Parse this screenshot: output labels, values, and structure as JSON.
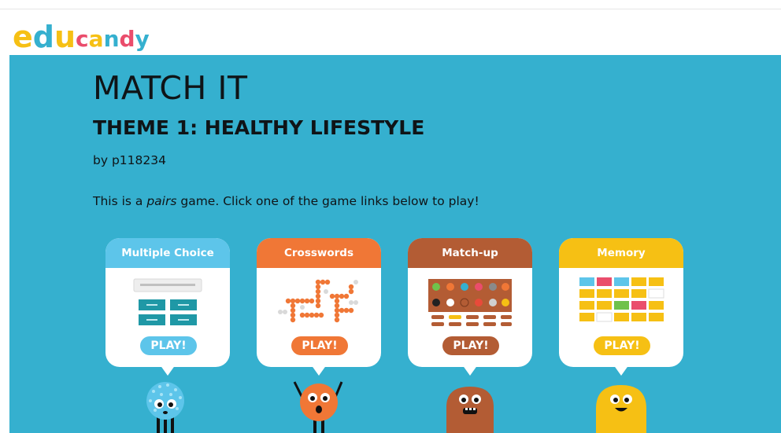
{
  "brand": {
    "logo_text": "educandy",
    "logo_letters": [
      "e",
      "d",
      "u",
      "c",
      "a",
      "n",
      "d",
      "y"
    ]
  },
  "page": {
    "title": "MATCH IT",
    "subtitle": "THEME 1: HEALTHY LIFESTYLE",
    "author": "by p118234",
    "desc_before": "This is a ",
    "desc_em": "pairs",
    "desc_after": " game. Click one of the game links below to play!"
  },
  "colors": {
    "background": "#35b0cf",
    "multiple_choice": "#5dc5ea",
    "crosswords": "#f07736",
    "matchup": "#b35c34",
    "memory": "#f6c014"
  },
  "games": [
    {
      "id": "multiple-choice",
      "title": "Multiple Choice",
      "play": "PLAY!"
    },
    {
      "id": "crosswords",
      "title": "Crosswords",
      "play": "PLAY!"
    },
    {
      "id": "match-up",
      "title": "Match-up",
      "play": "PLAY!"
    },
    {
      "id": "memory",
      "title": "Memory",
      "play": "PLAY!"
    }
  ]
}
